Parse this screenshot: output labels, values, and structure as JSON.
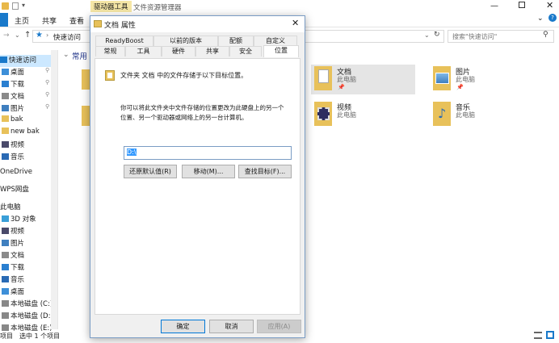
{
  "explorer": {
    "title_context_tab": "驱动器工具",
    "title": "文件资源管理器",
    "ribbon_tabs": [
      "主页",
      "共享",
      "查看"
    ],
    "address": "快速访问",
    "search_placeholder": "搜索\"快速访问\"",
    "section_header": "常用",
    "nav_items": [
      {
        "label": "快速访问",
        "icon": "star-icon",
        "pinned": false,
        "selected": true
      },
      {
        "label": "桌面",
        "icon": "desktop-icon",
        "pinned": true
      },
      {
        "label": "下载",
        "icon": "download-icon",
        "pinned": true
      },
      {
        "label": "文档",
        "icon": "document-icon",
        "pinned": true
      },
      {
        "label": "图片",
        "icon": "picture-icon",
        "pinned": true
      },
      {
        "label": "bak",
        "icon": "folder-icon",
        "pinned": false
      },
      {
        "label": "new bak",
        "icon": "folder-icon",
        "pinned": false
      },
      {
        "label": "视频",
        "icon": "video-icon",
        "pinned": false
      },
      {
        "label": "音乐",
        "icon": "music-icon",
        "pinned": false
      },
      {
        "label": "OneDrive",
        "icon": "cloud-icon",
        "pinned": false
      },
      {
        "label": "WPS网盘",
        "icon": "cloud-icon",
        "pinned": false
      },
      {
        "label": "此电脑",
        "icon": "computer-icon",
        "pinned": false
      },
      {
        "label": "3D 对象",
        "icon": "cube-icon",
        "pinned": false
      },
      {
        "label": "视频",
        "icon": "video-icon",
        "pinned": false
      },
      {
        "label": "图片",
        "icon": "picture-icon",
        "pinned": false
      },
      {
        "label": "文档",
        "icon": "document-icon",
        "pinned": false
      },
      {
        "label": "下载",
        "icon": "download-icon",
        "pinned": false
      },
      {
        "label": "音乐",
        "icon": "music-icon",
        "pinned": false
      },
      {
        "label": "桌面",
        "icon": "desktop-icon",
        "pinned": false
      },
      {
        "label": "本地磁盘 (C:)",
        "icon": "drive-icon",
        "pinned": false
      },
      {
        "label": "本地磁盘 (D:)",
        "icon": "drive-icon",
        "pinned": false
      },
      {
        "label": "本地磁盘 (E:)",
        "icon": "drive-icon",
        "pinned": false
      }
    ],
    "tiles": [
      {
        "name": "文档",
        "sub": "此电脑",
        "icon": "document-folder-icon",
        "selected": true
      },
      {
        "name": "图片",
        "sub": "此电脑",
        "icon": "picture-folder-icon",
        "selected": false
      },
      {
        "name": "视频",
        "sub": "此电脑",
        "icon": "video-folder-icon",
        "selected": false
      },
      {
        "name": "音乐",
        "sub": "此电脑",
        "icon": "music-folder-icon",
        "selected": false
      }
    ],
    "status_items": "项目",
    "status_selected": "选中 1 个项目"
  },
  "dialog": {
    "title": "文档 属性",
    "tabs_row1": [
      "ReadyBoost",
      "以前的版本",
      "配额",
      "自定义"
    ],
    "tabs_row2": [
      "常规",
      "工具",
      "硬件",
      "共享",
      "安全",
      "位置"
    ],
    "active_tab": "位置",
    "info_text": "文件夹 文档 中的文件存储于以下目标位置。",
    "desc_line1": "你可以将此文件夹中文件存储的位置更改为此硬盘上的另一个",
    "desc_line2": "位置、另一个驱动器或网络上的另一台计算机。",
    "path_value": "D:\\",
    "restore_button": "还原默认值(R)",
    "move_button": "移动(M)...",
    "find_target_button": "查找目标(F)...",
    "ok_button": "确定",
    "cancel_button": "取消",
    "apply_button": "应用(A)"
  },
  "colors": {
    "accent": "#1979ca",
    "context_tab_bg": "#f5e6a6",
    "selection": "#cce8ff",
    "tile_selected": "#e5e5e5"
  }
}
